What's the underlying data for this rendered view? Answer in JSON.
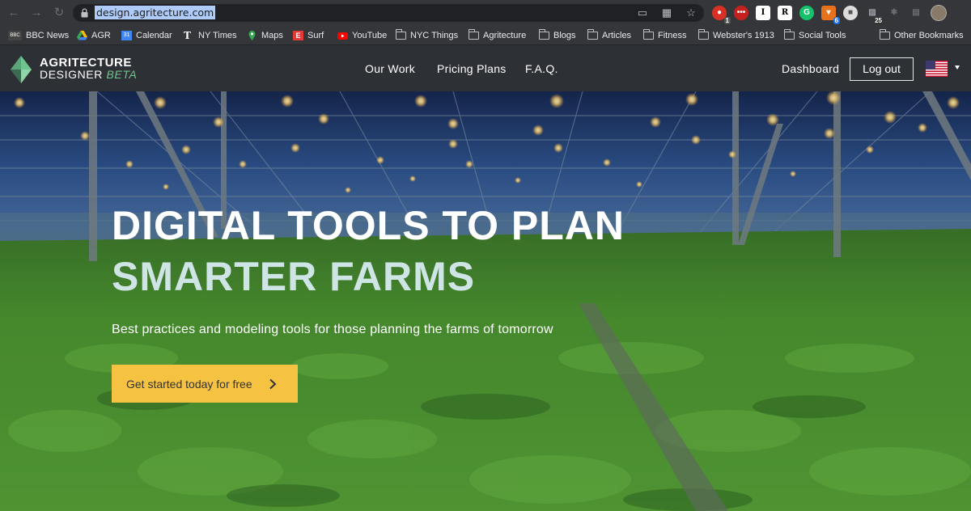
{
  "browser": {
    "url": "design.agritecture.com",
    "extension_badges": {
      "first": "1",
      "orange": "6",
      "count": "25"
    },
    "bookmarks": [
      {
        "label": "BBC News",
        "icon": "bbc-icon"
      },
      {
        "label": "AGR",
        "icon": "drive-icon"
      },
      {
        "label": "Calendar",
        "icon": "calendar-icon"
      },
      {
        "label": "NY Times",
        "icon": "nytimes-icon"
      },
      {
        "label": "Maps",
        "icon": "maps-icon"
      },
      {
        "label": "Surf",
        "icon": "surf-icon"
      },
      {
        "label": "YouTube",
        "icon": "youtube-icon"
      },
      {
        "label": "NYC Things",
        "icon": "folder-icon"
      },
      {
        "label": "Agritecture",
        "icon": "folder-icon"
      },
      {
        "label": "Blogs",
        "icon": "folder-icon"
      },
      {
        "label": "Articles",
        "icon": "folder-icon"
      },
      {
        "label": "Fitness",
        "icon": "folder-icon"
      },
      {
        "label": "Webster's 1913",
        "icon": "folder-icon"
      },
      {
        "label": "Social Tools",
        "icon": "folder-icon"
      },
      {
        "label": "Other Bookmarks",
        "icon": "folder-icon"
      }
    ]
  },
  "site": {
    "logo": {
      "line1": "AGRITECTURE",
      "line2": "DESIGNER",
      "beta": "BETA"
    },
    "menu": [
      "Our Work",
      "Pricing Plans",
      "F.A.Q."
    ],
    "dashboard": "Dashboard",
    "logout": "Log out",
    "language_icon": "us-flag-icon"
  },
  "hero": {
    "title_line1": "DIGITAL TOOLS TO PLAN",
    "title_line2": "SMARTER FARMS",
    "subtitle": "Best practices and modeling tools for those planning the farms of tomorrow",
    "cta": "Get started today for free"
  },
  "colors": {
    "nav_bg": "#2d3034",
    "accent_green": "#6fc48f",
    "cta_yellow": "#f5c242",
    "title_secondary": "#cfe4e4"
  }
}
